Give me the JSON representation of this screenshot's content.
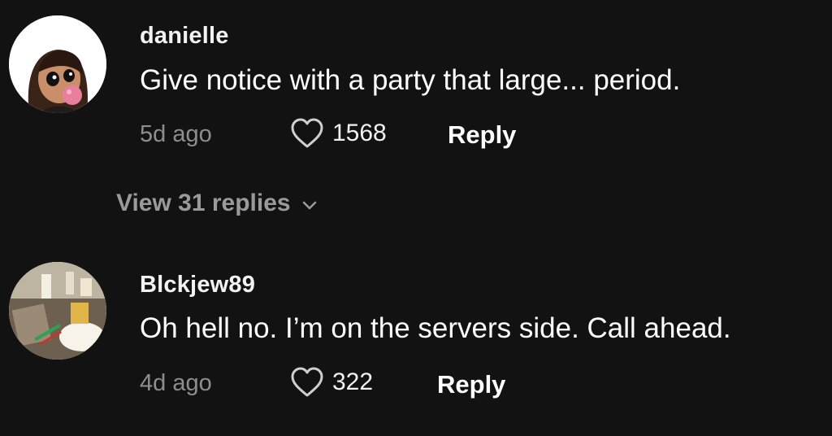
{
  "comments": [
    {
      "username": "danielle",
      "text": "Give notice with a party that large... period.",
      "time": "5d ago",
      "likes": "1568",
      "reply_label": "Reply",
      "avatar_icon": "cartoon-girl-bubblegum-avatar"
    },
    {
      "username": "Blckjew89",
      "text": "Oh hell no. I’m on the servers side. Call ahead.",
      "time": "4d ago",
      "likes": "322",
      "reply_label": "Reply",
      "avatar_icon": "restaurant-table-photo-avatar"
    }
  ],
  "view_replies_label": "View 31 replies",
  "icons": {
    "like": "heart-outline-icon",
    "expand": "chevron-down-icon"
  },
  "colors": {
    "background": "#121212",
    "primary_text": "#ffffff",
    "secondary_text": "#8e8e8e"
  }
}
